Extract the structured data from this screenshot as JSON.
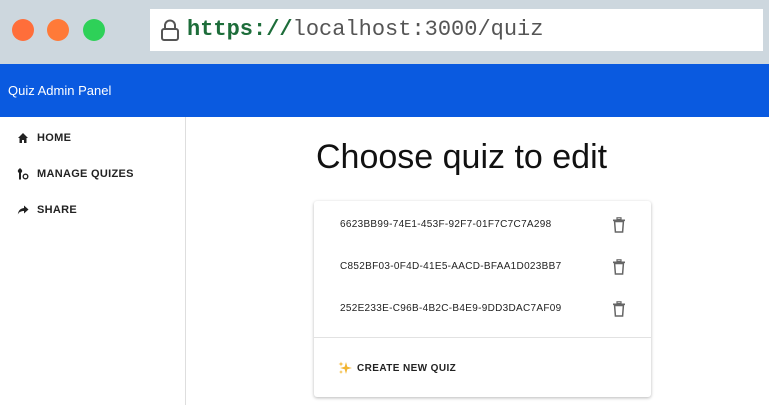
{
  "browser": {
    "url_scheme": "https://",
    "url_rest": "localhost:3000/quiz"
  },
  "app": {
    "title": "Quiz Admin Panel"
  },
  "sidebar": {
    "items": [
      {
        "label": "HOME",
        "icon": "home-icon"
      },
      {
        "label": "MANAGE QUIZES",
        "icon": "manage-icon"
      },
      {
        "label": "SHARE",
        "icon": "share-arrow-icon"
      }
    ]
  },
  "main": {
    "heading": "Choose quiz to edit",
    "quizzes": [
      {
        "id": "6623BB99-74E1-453F-92F7-01F7C7C7A298"
      },
      {
        "id": "C852BF03-0F4D-41E5-AACD-BFAA1D023BB7"
      },
      {
        "id": "252E233E-C96B-4B2C-B4E9-9DD3DAC7AF09"
      }
    ],
    "create_label": "CREATE NEW QUIZ"
  },
  "colors": {
    "app_bar": "#0a5ae0",
    "chrome": "#cdd7de",
    "url_scheme": "#1d6d3a"
  }
}
